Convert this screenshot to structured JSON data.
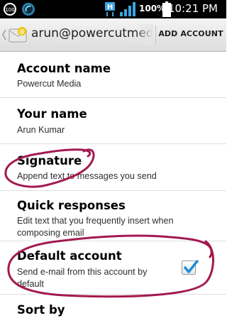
{
  "status_bar": {
    "time": "10:21 PM",
    "battery_percent": "100%",
    "icons": [
      "notification-badge-icon",
      "app-circle-icon",
      "h-network-icon",
      "signal-bars-icon",
      "battery-icon"
    ]
  },
  "action_bar": {
    "title": "arun@powercutmedi",
    "add_account_label": "ADD ACCOUNT",
    "icons": [
      "back-chevron-icon",
      "email-app-icon"
    ]
  },
  "settings": {
    "items": [
      {
        "title": "Account name",
        "summary": "Powercut Media"
      },
      {
        "title": "Your name",
        "summary": "Arun Kumar"
      },
      {
        "title": "Signature",
        "summary": "Append text to messages you send"
      },
      {
        "title": "Quick responses",
        "summary_line1": "Edit text that you frequently insert when",
        "summary_line2": "composing email"
      },
      {
        "title": "Default account",
        "summary_line1": "Send e-mail from this account by",
        "summary_line2": "default",
        "checked": true
      },
      {
        "title": "Sort by"
      }
    ]
  },
  "colors": {
    "annotation_stroke": "#a2194f",
    "checkbox_check": "#1d8fd6",
    "status_bar_bg": "#000000"
  }
}
